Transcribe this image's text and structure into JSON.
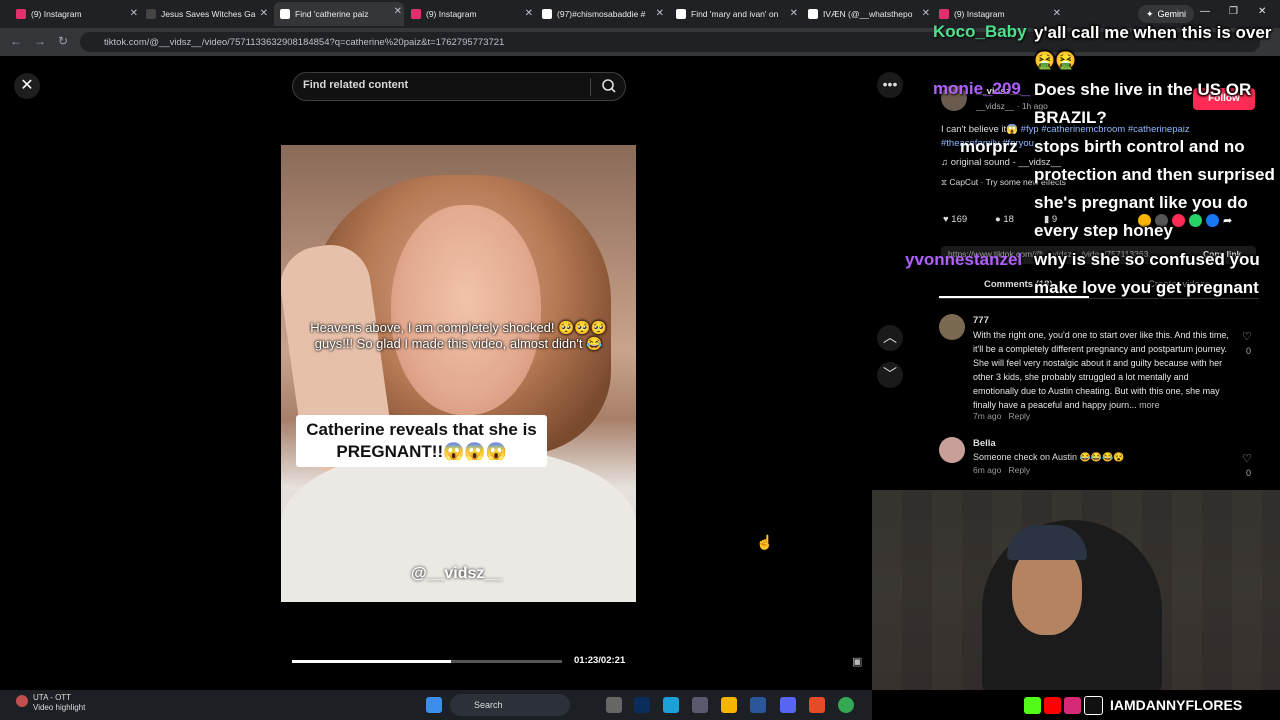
{
  "browser": {
    "tabs": [
      {
        "title": "(9) Instagram",
        "color": "#e1306c"
      },
      {
        "title": "Jesus Saves Witches Ga",
        "color": "#444444"
      },
      {
        "title": "Find 'catherine paiz",
        "color": "#ffffff"
      },
      {
        "title": "(9) Instagram",
        "color": "#e1306c"
      },
      {
        "title": "(97)#chismosabaddie #",
        "color": "#ffffff"
      },
      {
        "title": "Find 'mary and ivan' on",
        "color": "#ffffff"
      },
      {
        "title": "IVÆN (@__whatsthepo",
        "color": "#ffffff"
      },
      {
        "title": "(9) Instagram",
        "color": "#e1306c"
      }
    ],
    "gemini_label": "Gemini",
    "url": "tiktok.com/@__vidsz__/video/7571133632908184854?q=catherine%20paiz&t=1762795773721"
  },
  "search": {
    "placeholder": "Find related content"
  },
  "video": {
    "caption_line1": "Heavens above, I am completely shocked! 🥺🥺🥺",
    "caption_line2": "guys!!! So glad I made this video, almost didn't 😂",
    "label": "Catherine reveals that she is PREGNANT!!😱😱😱",
    "watermark": "@__vidsz__",
    "time": "01:23/02:21",
    "progress": 0.59
  },
  "post": {
    "username": "__vidsz__",
    "meta": "__vidsz__ · 1h ago",
    "follow_label": "Follow",
    "description": "I can't believe it😱",
    "tags": "#fyp #catherinemcbroom #catherinepaiz",
    "tags2": "#theacefamily #foryou",
    "sound": "original sound - __vidsz__",
    "capcut": "CapCut · Try some new effects",
    "likes": "169",
    "comments_count": "18",
    "saves": "9",
    "link": "https://www.tiktok.com/@__vidsz__/video/757113363...",
    "copy_link": "Copy link",
    "tab_comments": "Comments (18)",
    "tab_creator": "Creator videos"
  },
  "comments": [
    {
      "user": "777",
      "text": "With the right one, you'd one to start over like this. And this time, it'll be a completely different pregnancy and postpartum journey. She will feel very nostalgic about it and guilty because with her other 3 kids, she probably struggled a lot mentally and emotionally due to Austin cheating. But with this one, she may finally have a peaceful and happy journ...",
      "more": "more",
      "time": "7m ago",
      "reply": "Reply",
      "likes": "0"
    },
    {
      "user": "Bella",
      "text": "Someone check on Austin 😂😂😂😵",
      "time": "6m ago",
      "reply": "Reply",
      "likes": "0"
    }
  ],
  "chat": [
    {
      "user": "Koco_Baby",
      "color": "#4ee08a",
      "msg": "y'all call me when this is over 🤮🤮"
    },
    {
      "user": "monie_209_",
      "color": "#b060ff",
      "msg": "Does she live in the US OR BRAZIL?"
    },
    {
      "user": "morprz",
      "color": "#ffffff",
      "msg": "stops birth control and no protection and then surprised she's pregnant like you do every step honey"
    },
    {
      "user": "yvonnestanzel",
      "color": "#b060ff",
      "msg": "why is she so confused you make love you get pregnant"
    }
  ],
  "stream": {
    "handle": "IAMDANNYFLORES"
  },
  "taskbar": {
    "weather_line1": "UTA - OTT",
    "weather_line2": "Video highlight",
    "search_label": "Search"
  }
}
